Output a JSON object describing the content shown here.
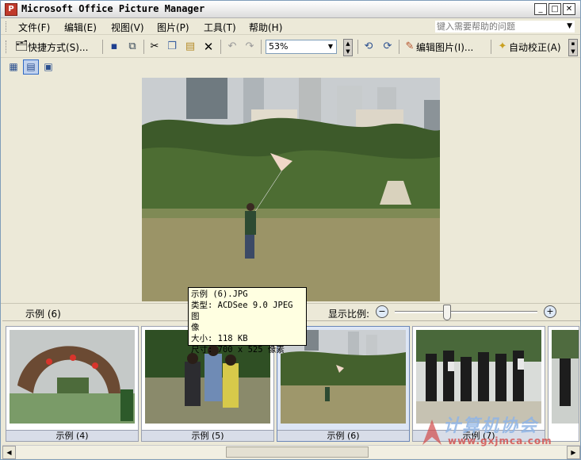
{
  "window": {
    "title": "Microsoft Office Picture Manager",
    "buttons": [
      "_",
      "□",
      "✕"
    ]
  },
  "menu": {
    "items": [
      "文件(F)",
      "编辑(E)",
      "视图(V)",
      "图片(P)",
      "工具(T)",
      "帮助(H)"
    ],
    "help_placeholder": "键入需要帮助的问题"
  },
  "toolbar": {
    "shortcuts_label": "快捷方式(S)...",
    "zoom_value": "53%",
    "edit_picture_label": "编辑图片(I)...",
    "auto_correct_label": "自动校正(A)"
  },
  "status": {
    "current_name": "示例 (6)",
    "zoom_label": "显示比例:",
    "zoom_slider_fraction": 0.36
  },
  "tooltip": {
    "lines": [
      "示例 (6).JPG",
      "类型: ACDSee 9.0 JPEG 图",
      "像",
      "大小: 118 KB",
      "尺寸: 700 x 525 像素"
    ]
  },
  "filmstrip": {
    "thumbnails": [
      {
        "caption": "示例 (4)"
      },
      {
        "caption": "示例 (5)"
      },
      {
        "caption": "示例 (6)"
      },
      {
        "caption": "示例 (7)"
      }
    ]
  },
  "watermark": {
    "title": "计算机协会",
    "url": "www.gxjmca.com"
  }
}
